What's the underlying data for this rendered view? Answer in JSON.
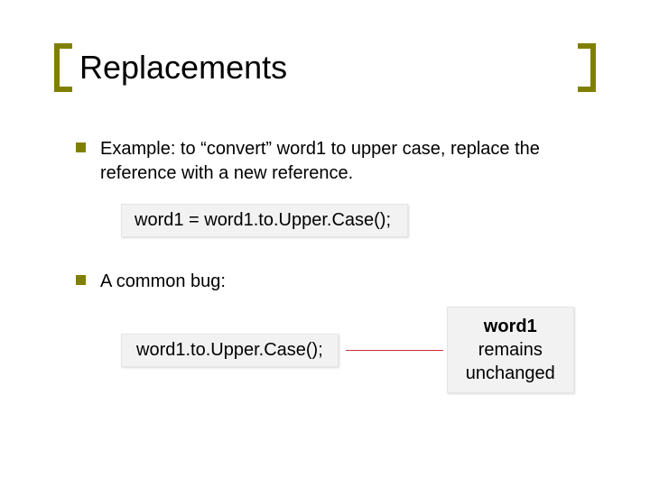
{
  "title": "Replacements",
  "bullets": [
    "Example: to “convert” word1 to upper case, replace the reference with a new reference.",
    "A common bug:"
  ],
  "code1": "word1 = word1.to.Upper.Case();",
  "code2": "word1.to.Upper.Case();",
  "note_strong": "word1",
  "note_rest_line2": "remains",
  "note_rest_line3": "unchanged"
}
